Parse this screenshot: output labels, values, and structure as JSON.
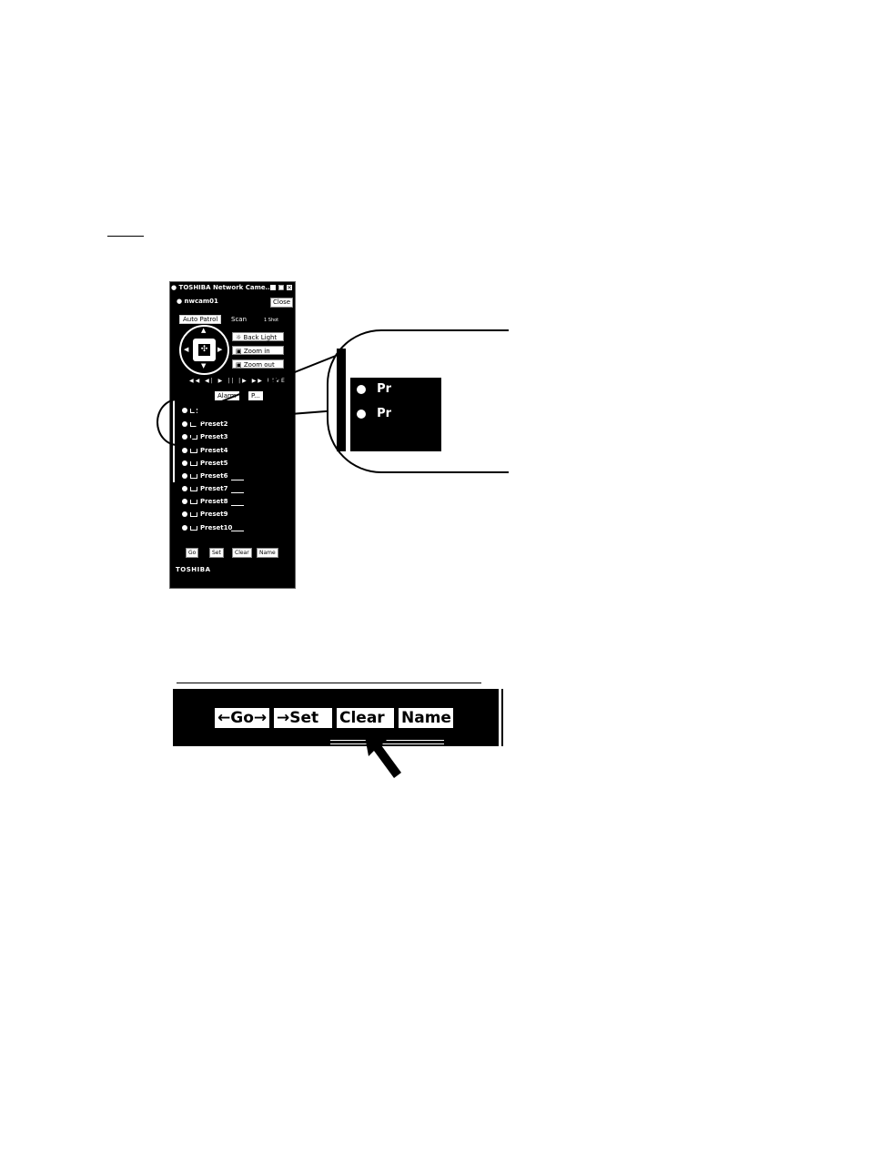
{
  "window": {
    "title": "TOSHIBA Network Came...",
    "camera_name": "nwcam01",
    "close_label": "Close",
    "tabs": [
      "Auto Patrol",
      "Scan",
      "1 Shot"
    ],
    "controls": [
      "Back Light",
      "Zoom in",
      "Zoom out"
    ],
    "media_label": "LIVE",
    "lower_tabs": [
      "Alarm",
      "P..."
    ],
    "presets": [
      "Preset2",
      "Preset3",
      "Preset4",
      "Preset5",
      "Preset6",
      "Preset7",
      "Preset8",
      "Preset9",
      "Preset10"
    ],
    "buttons": [
      "Go",
      "Set",
      "Clear",
      "Name"
    ],
    "brand": "TOSHIBA"
  },
  "zoom_callout": {
    "line1": "Pr",
    "line2": "Pr"
  },
  "enlarged_buttons": {
    "items": [
      "Go",
      "Set",
      "Clear",
      "Name"
    ]
  }
}
